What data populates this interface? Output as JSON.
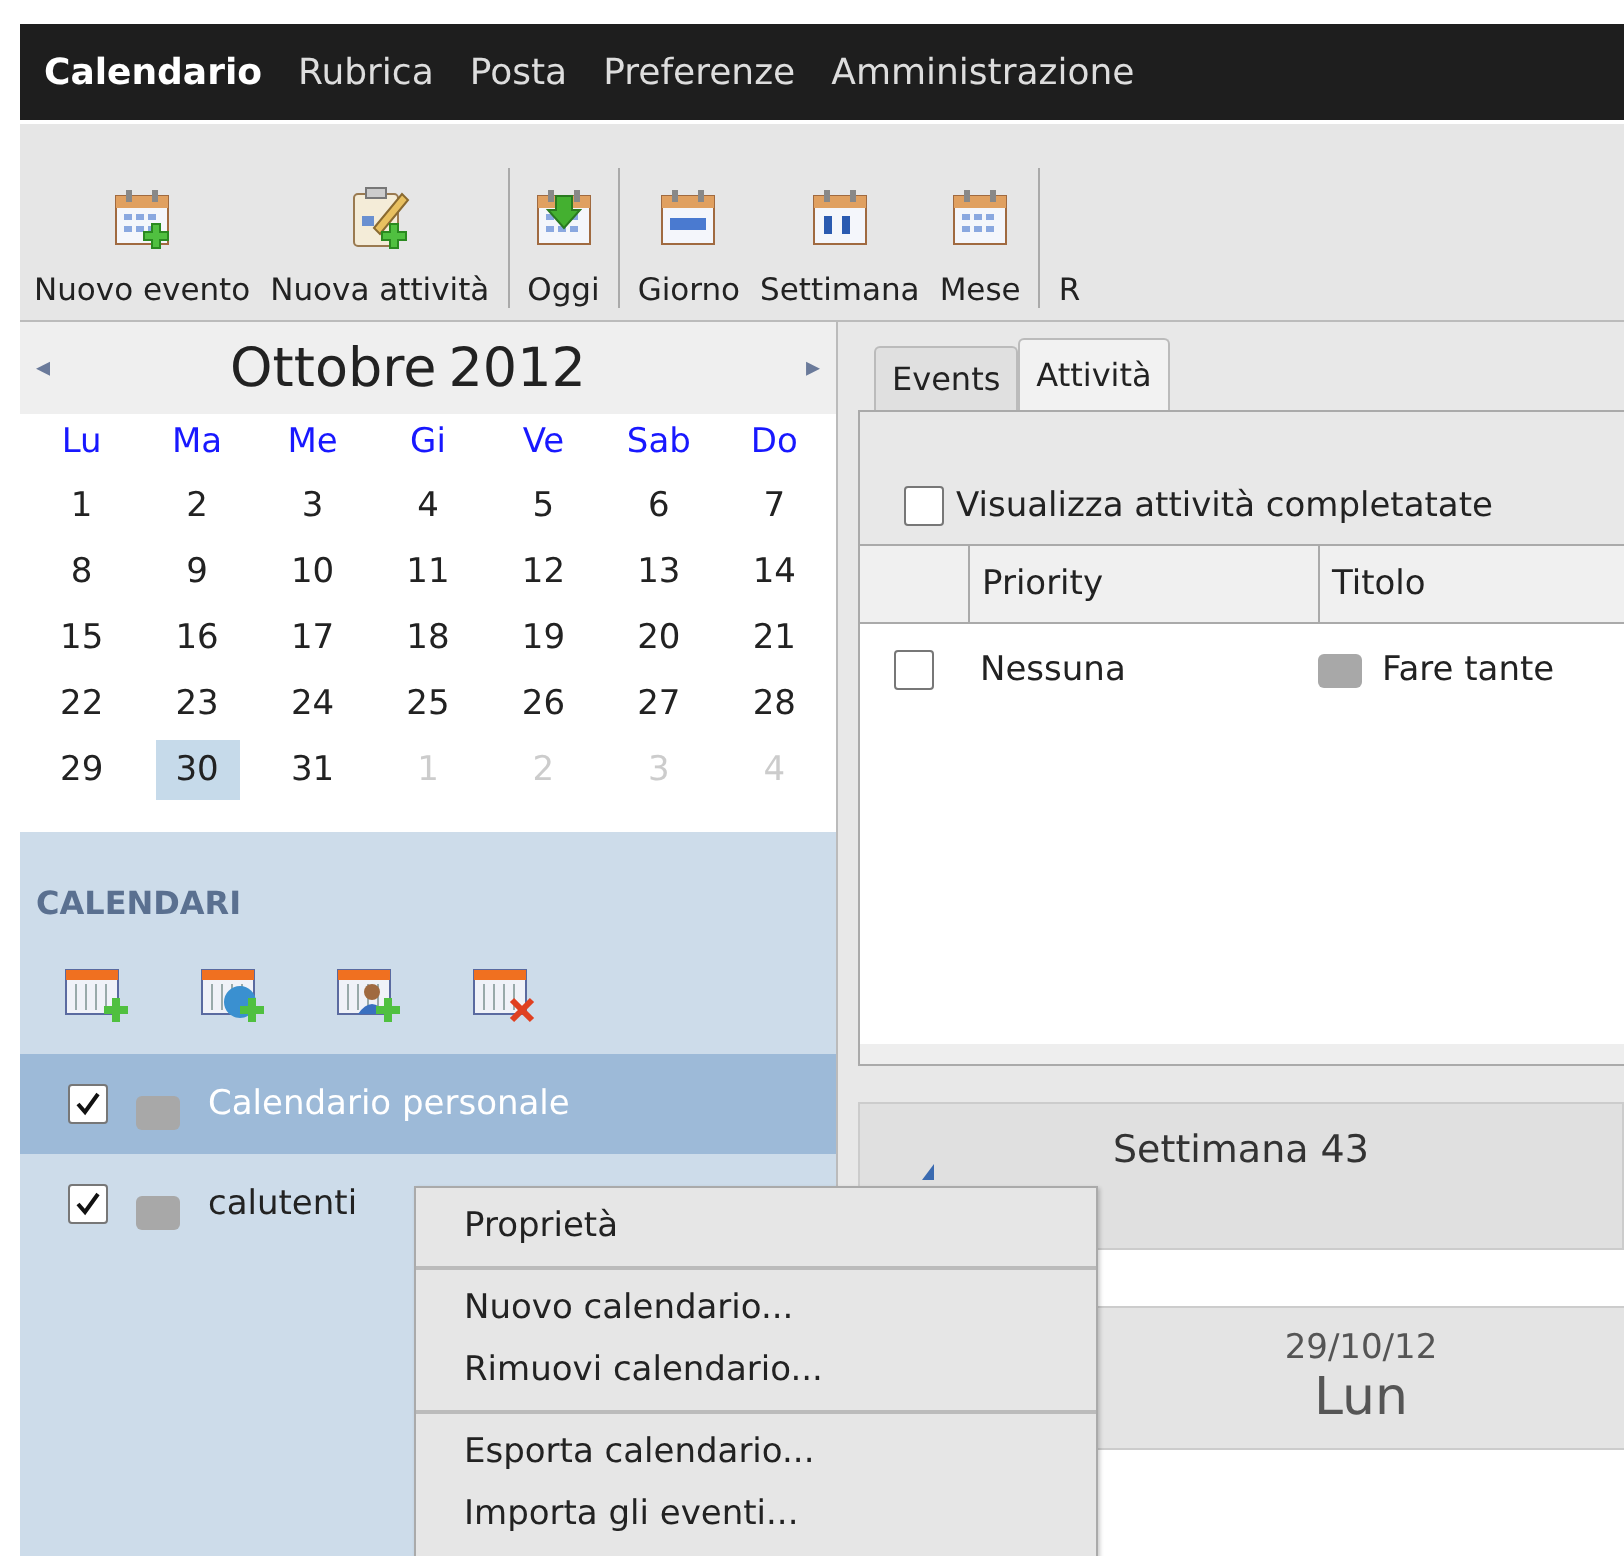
{
  "menu_bar": {
    "items": [
      {
        "label": "Calendario",
        "selected": true
      },
      {
        "label": "Rubrica",
        "selected": false
      },
      {
        "label": "Posta",
        "selected": false
      },
      {
        "label": "Preferenze",
        "selected": false
      },
      {
        "label": "Amministrazione",
        "selected": false
      }
    ]
  },
  "toolbar": {
    "items": [
      {
        "kind": "new-event",
        "label": "Nuovo evento"
      },
      {
        "kind": "new-task",
        "label": "Nuova attività"
      },
      {
        "kind": "separator"
      },
      {
        "kind": "today",
        "label": "Oggi"
      },
      {
        "kind": "separator"
      },
      {
        "kind": "day",
        "label": "Giorno"
      },
      {
        "kind": "week",
        "label": "Settimana"
      },
      {
        "kind": "month",
        "label": "Mese"
      },
      {
        "kind": "separator"
      },
      {
        "kind": "cut",
        "label": "R"
      }
    ]
  },
  "mini_calendar": {
    "month": "Ottobre",
    "year": "2012",
    "prev": "◂",
    "next": "▸",
    "weekdays": [
      "Lu",
      "Ma",
      "Me",
      "Gi",
      "Ve",
      "Sab",
      "Do"
    ],
    "weeks": [
      [
        {
          "day": "1",
          "other_month": false,
          "selected": false
        },
        {
          "day": "2",
          "other_month": false,
          "selected": false
        },
        {
          "day": "3",
          "other_month": false,
          "selected": false
        },
        {
          "day": "4",
          "other_month": false,
          "selected": false
        },
        {
          "day": "5",
          "other_month": false,
          "selected": false
        },
        {
          "day": "6",
          "other_month": false,
          "selected": false
        },
        {
          "day": "7",
          "other_month": false,
          "selected": false
        }
      ],
      [
        {
          "day": "8",
          "other_month": false,
          "selected": false
        },
        {
          "day": "9",
          "other_month": false,
          "selected": false
        },
        {
          "day": "10",
          "other_month": false,
          "selected": false
        },
        {
          "day": "11",
          "other_month": false,
          "selected": false
        },
        {
          "day": "12",
          "other_month": false,
          "selected": false
        },
        {
          "day": "13",
          "other_month": false,
          "selected": false
        },
        {
          "day": "14",
          "other_month": false,
          "selected": false
        }
      ],
      [
        {
          "day": "15",
          "other_month": false,
          "selected": false
        },
        {
          "day": "16",
          "other_month": false,
          "selected": false
        },
        {
          "day": "17",
          "other_month": false,
          "selected": false
        },
        {
          "day": "18",
          "other_month": false,
          "selected": false
        },
        {
          "day": "19",
          "other_month": false,
          "selected": false
        },
        {
          "day": "20",
          "other_month": false,
          "selected": false
        },
        {
          "day": "21",
          "other_month": false,
          "selected": false
        }
      ],
      [
        {
          "day": "22",
          "other_month": false,
          "selected": false
        },
        {
          "day": "23",
          "other_month": false,
          "selected": false
        },
        {
          "day": "24",
          "other_month": false,
          "selected": false
        },
        {
          "day": "25",
          "other_month": false,
          "selected": false
        },
        {
          "day": "26",
          "other_month": false,
          "selected": false
        },
        {
          "day": "27",
          "other_month": false,
          "selected": false
        },
        {
          "day": "28",
          "other_month": false,
          "selected": false
        }
      ],
      [
        {
          "day": "29",
          "other_month": false,
          "selected": false
        },
        {
          "day": "30",
          "other_month": false,
          "selected": true
        },
        {
          "day": "31",
          "other_month": false,
          "selected": false
        },
        {
          "day": "1",
          "other_month": true,
          "selected": false
        },
        {
          "day": "2",
          "other_month": true,
          "selected": false
        },
        {
          "day": "3",
          "other_month": true,
          "selected": false
        },
        {
          "day": "4",
          "other_month": true,
          "selected": false
        }
      ]
    ]
  },
  "calendars": {
    "title": "CALENDARI",
    "actions": [
      {
        "kind": "new"
      },
      {
        "kind": "web"
      },
      {
        "kind": "shared"
      },
      {
        "kind": "delete"
      }
    ],
    "items": [
      {
        "name": "Calendario personale",
        "checked": true,
        "color": "#a8a8a8",
        "selected": true
      },
      {
        "name": "calutenti",
        "checked": true,
        "color": "#a8a8a8",
        "selected": false
      }
    ]
  },
  "tabs": [
    {
      "label": "Events",
      "selected": false
    },
    {
      "label": "Attività",
      "selected": true
    }
  ],
  "tasks": {
    "show_completed": {
      "label": "Visualizza attività completatate",
      "checked": false
    },
    "columns": [
      "Priority",
      "Titolo"
    ],
    "rows": [
      {
        "done": false,
        "priority": "Nessuna",
        "color": "#a8a8a8",
        "title": "Fare tante"
      }
    ]
  },
  "week_view": {
    "title": "Settimana 43",
    "days": [
      {
        "date": "29/10/12",
        "weekday": "Lun"
      }
    ]
  },
  "context_menu": {
    "groups": [
      [
        "Proprietà"
      ],
      [
        "Nuovo calendario...",
        "Rimuovi calendario..."
      ],
      [
        "Esporta calendario...",
        "Importa gli eventi..."
      ]
    ]
  }
}
